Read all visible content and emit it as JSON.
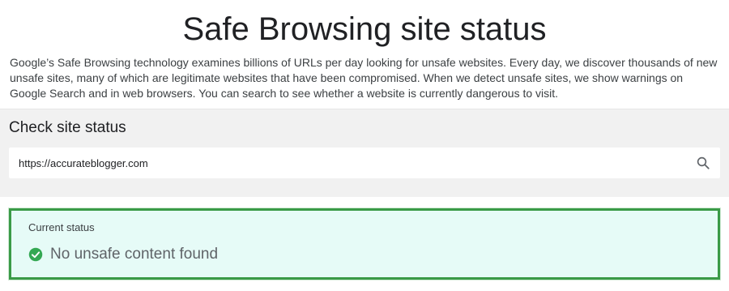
{
  "header": {
    "title": "Safe Browsing site status",
    "intro": "Google’s Safe Browsing technology examines billions of URLs per day looking for unsafe websites. Every day, we discover thousands of new unsafe sites, many of which are legitimate websites that have been compromised. When we detect unsafe sites, we show warnings on Google Search and in web browsers. You can search to see whether a website is currently dangerous to visit."
  },
  "check": {
    "heading": "Check site status",
    "input_value": "https://accurateblogger.com",
    "search_icon": "search-icon"
  },
  "status": {
    "label": "Current status",
    "result": "No unsafe content found",
    "result_icon": "check-circle-icon",
    "colors": {
      "border": "#3a9a47",
      "background": "#e6fbf7",
      "icon": "#34a853"
    }
  }
}
